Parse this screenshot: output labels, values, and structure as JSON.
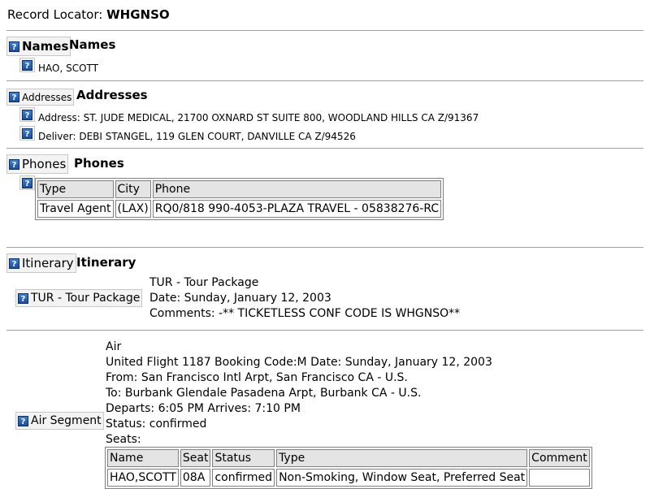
{
  "record": {
    "label": "Record Locator:",
    "value": "WHGNSO"
  },
  "names": {
    "button": "Names",
    "title": "Names",
    "entries": [
      "HAO, SCOTT"
    ]
  },
  "addresses": {
    "button": "Addresses",
    "title": "Addresses",
    "address": "Address: ST. JUDE MEDICAL, 21700 OXNARD ST SUITE 800, WOODLAND HILLS CA Z/91367",
    "deliver": "Deliver: DEBI STANGEL, 119 GLEN COURT, DANVILLE CA Z/94526"
  },
  "phones": {
    "button": "Phones",
    "title": "Phones",
    "headers": [
      "Type",
      "City",
      "Phone"
    ],
    "rows": [
      [
        "Travel Agent",
        "(LAX)",
        "RQ0/818 990-4053-PLAZA TRAVEL - 05838276-RC"
      ]
    ]
  },
  "itinerary": {
    "button": "Itinerary",
    "title": "Itinerary",
    "tour": {
      "button": "TUR - Tour Package",
      "lines": [
        "TUR - Tour Package",
        "Date: Sunday, January 12, 2003",
        "Comments: -** TICKETLESS CONF CODE IS WHGNSO**"
      ]
    },
    "air": {
      "button": "Air Segment",
      "lines": [
        "Air",
        "United Flight 1187 Booking Code:M Date: Sunday, January 12, 2003",
        "From: San Francisco Intl Arpt, San Francisco CA - U.S.",
        "To: Burbank Glendale Pasadena Arpt, Burbank CA - U.S.",
        "Departs: 6:05 PM Arrives: 7:10 PM",
        "Status: confirmed",
        "Seats:"
      ],
      "seat_headers": [
        "Name",
        "Seat",
        "Status",
        "Type",
        "Comment"
      ],
      "seat_rows": [
        [
          "HAO,SCOTT",
          "08A",
          "confirmed",
          "Non-Smoking, Window Seat, Preferred Seat",
          ""
        ]
      ]
    }
  },
  "icons": {
    "help": "?"
  }
}
